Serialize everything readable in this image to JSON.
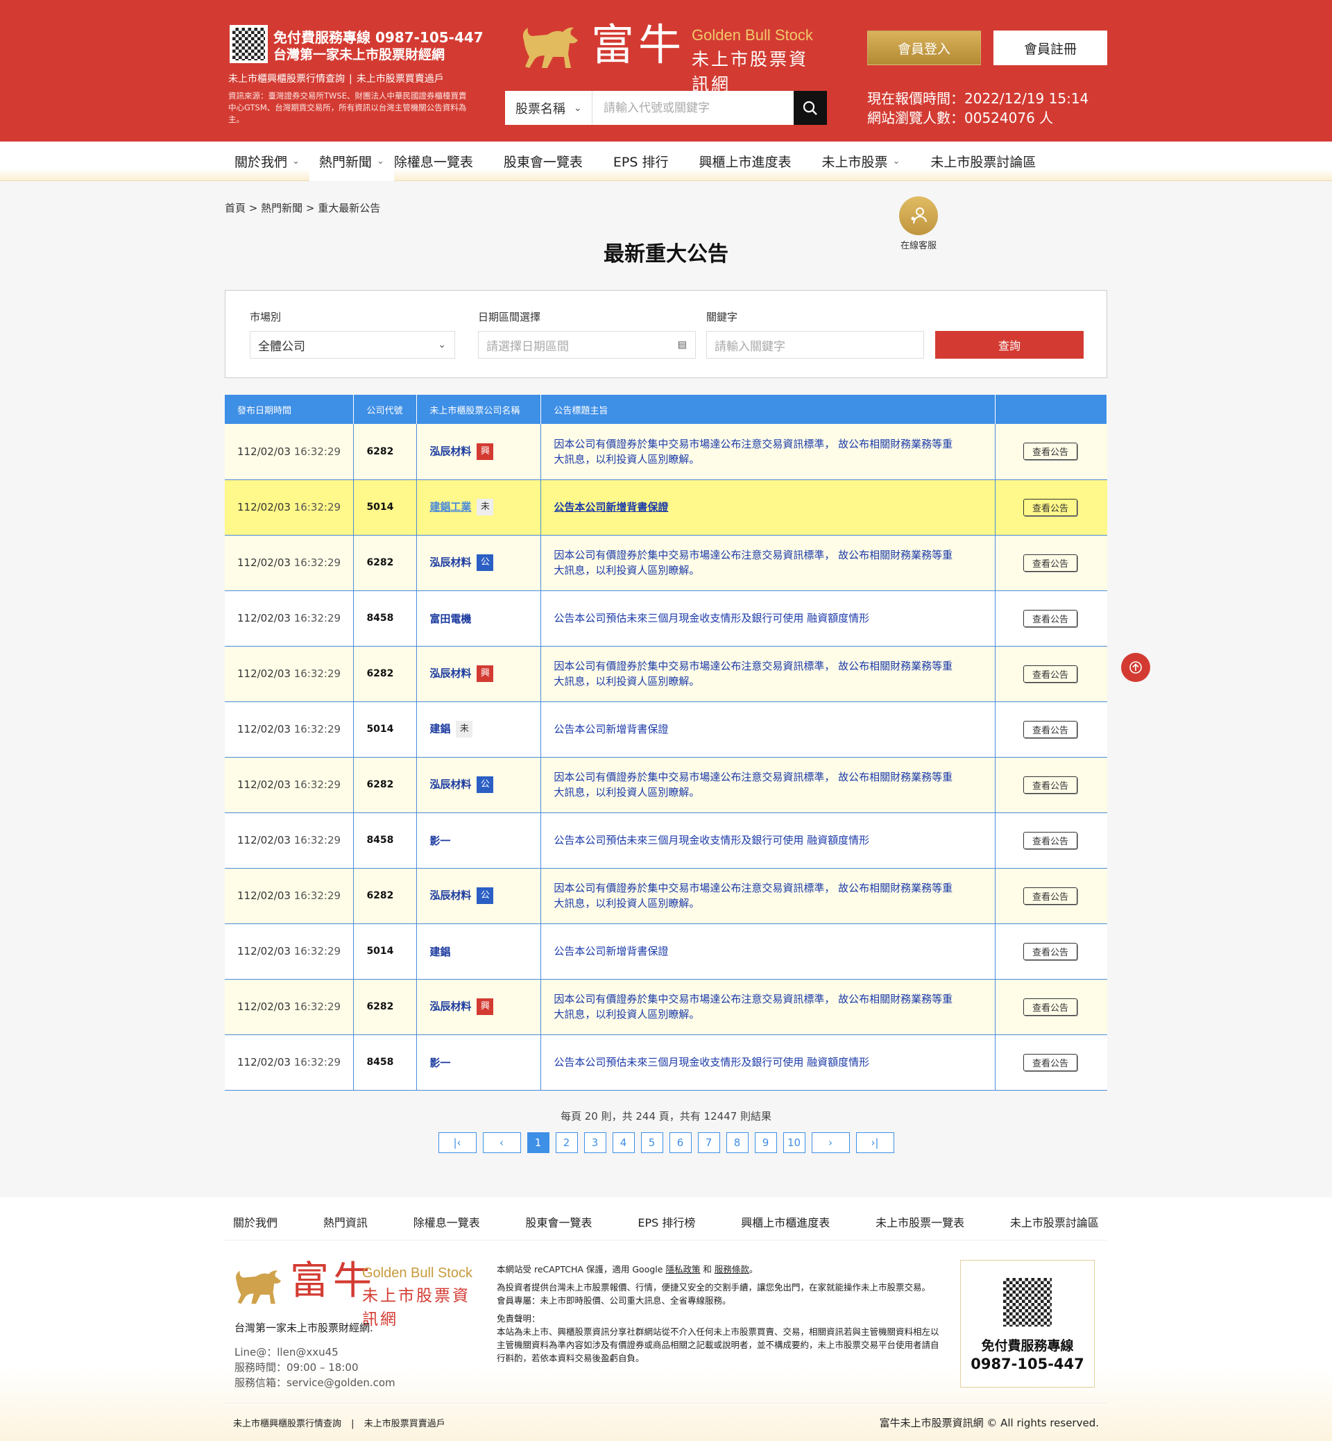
{
  "header": {
    "hotline": "免付費服務專線 0987-105-447",
    "slogan": "台灣第一家未上市股票財經網",
    "links": [
      "未上市櫃興櫃股票行情查詢",
      "|",
      "未上市股票買賣過戶"
    ],
    "source": "資訊來源：臺灣證券交易所TWSE、財團法人中華民國證券櫃檯買賣中心GTSM、台灣期貨交易所，所有資訊以台灣主管機關公告資料為主。",
    "logo_cn": "富牛",
    "logo_en": "Golden Bull Stock",
    "logo_sub": "未上市股票資訊網",
    "search_select": "股票名稱",
    "search_placeholder": "請輸入代號或關鍵字",
    "login": "會員登入",
    "register": "會員註冊",
    "quote_time": "現在報價時間：2022/12/19 15:14",
    "visitors": "網站瀏覽人數：00524076 人",
    "accent": "#d33b32"
  },
  "nav": [
    {
      "label": "關於我們",
      "dropdown": true
    },
    {
      "label": "熱門新聞",
      "dropdown": true,
      "active": true
    },
    {
      "label": "除權息一覽表"
    },
    {
      "label": "股東會一覽表"
    },
    {
      "label": "EPS 排行"
    },
    {
      "label": "興櫃上市進度表"
    },
    {
      "label": "未上市股票",
      "dropdown": true
    },
    {
      "label": "未上市股票討論區"
    }
  ],
  "breadcrumb": "首頁 > 熱門新聞 > 重大最新公告",
  "service_label": "在線客服",
  "page_title": "最新重大公告",
  "filter": {
    "market_label": "市場別",
    "market_value": "全體公司",
    "date_label": "日期區間選擇",
    "date_placeholder": "請選擇日期區間",
    "keyword_label": "關鍵字",
    "keyword_placeholder": "請輸入關鍵字",
    "query": "查詢"
  },
  "table": {
    "headers": [
      "發布日期時間",
      "公司代號",
      "未上市櫃股票公司名稱",
      "公告標題主旨",
      ""
    ],
    "view_label": "查看公告",
    "rows": [
      {
        "date": "112/02/03",
        "time": "16:32:29",
        "code": "6282",
        "name": "泓辰材料",
        "badge": "興",
        "btype": "xing",
        "subject": "因本公司有價證券於集中交易市場達公布注意交易資訊標準， 故公布相關財務業務等重大訊息，以利投資人區別瞭解。",
        "style": "alt"
      },
      {
        "date": "112/02/03",
        "time": "16:32:29",
        "code": "5014",
        "name": "建錩工業",
        "badge": "未",
        "btype": "wei",
        "subject": "公告本公司新增背書保證",
        "style": "hl"
      },
      {
        "date": "112/02/03",
        "time": "16:32:29",
        "code": "6282",
        "name": "泓辰材料",
        "badge": "公",
        "btype": "gong",
        "subject": "因本公司有價證券於集中交易市場達公布注意交易資訊標準， 故公布相關財務業務等重大訊息，以利投資人區別瞭解。",
        "style": "alt"
      },
      {
        "date": "112/02/03",
        "time": "16:32:29",
        "code": "8458",
        "name": "富田電機",
        "badge": "",
        "btype": "",
        "subject": "公告本公司預估未來三個月現金收支情形及銀行可使用 融資額度情形",
        "style": ""
      },
      {
        "date": "112/02/03",
        "time": "16:32:29",
        "code": "6282",
        "name": "泓辰材料",
        "badge": "興",
        "btype": "xing",
        "subject": "因本公司有價證券於集中交易市場達公布注意交易資訊標準， 故公布相關財務業務等重大訊息，以利投資人區別瞭解。",
        "style": "alt"
      },
      {
        "date": "112/02/03",
        "time": "16:32:29",
        "code": "5014",
        "name": "建錩",
        "badge": "未",
        "btype": "wei",
        "subject": "公告本公司新增背書保證",
        "style": ""
      },
      {
        "date": "112/02/03",
        "time": "16:32:29",
        "code": "6282",
        "name": "泓辰材料",
        "badge": "公",
        "btype": "gong",
        "subject": "因本公司有價證券於集中交易市場達公布注意交易資訊標準， 故公布相關財務業務等重大訊息，以利投資人區別瞭解。",
        "style": "alt"
      },
      {
        "date": "112/02/03",
        "time": "16:32:29",
        "code": "8458",
        "name": "影一",
        "badge": "",
        "btype": "",
        "subject": "公告本公司預估未來三個月現金收支情形及銀行可使用 融資額度情形",
        "style": ""
      },
      {
        "date": "112/02/03",
        "time": "16:32:29",
        "code": "6282",
        "name": "泓辰材料",
        "badge": "公",
        "btype": "gong",
        "subject": "因本公司有價證券於集中交易市場達公布注意交易資訊標準， 故公布相關財務業務等重大訊息，以利投資人區別瞭解。",
        "style": "alt"
      },
      {
        "date": "112/02/03",
        "time": "16:32:29",
        "code": "5014",
        "name": "建錩",
        "badge": "",
        "btype": "",
        "subject": "公告本公司新增背書保證",
        "style": ""
      },
      {
        "date": "112/02/03",
        "time": "16:32:29",
        "code": "6282",
        "name": "泓辰材料",
        "badge": "興",
        "btype": "xing",
        "subject": "因本公司有價證券於集中交易市場達公布注意交易資訊標準， 故公布相關財務業務等重大訊息，以利投資人區別瞭解。",
        "style": "alt"
      },
      {
        "date": "112/02/03",
        "time": "16:32:29",
        "code": "8458",
        "name": "影一",
        "badge": "",
        "btype": "",
        "subject": "公告本公司預估未來三個月現金收支情形及銀行可使用 融資額度情形",
        "style": ""
      }
    ]
  },
  "pagination": {
    "info": "每頁 20 則，共 244 頁，共有 12447 則結果",
    "pages": [
      "1",
      "2",
      "3",
      "4",
      "5",
      "6",
      "7",
      "8",
      "9",
      "10"
    ],
    "current": "1"
  },
  "footer": {
    "nav": [
      "關於我們",
      "熱門資訊",
      "除權息一覽表",
      "股東會一覽表",
      "EPS 排行榜",
      "興櫃上市櫃進度表",
      "未上市股票一覽表",
      "未上市股票討論區"
    ],
    "tagline": "台灣第一家未上市股票財經網.",
    "line": "Line@：llen@xxu45",
    "hours": "服務時間：09:00 – 18:00",
    "mail": "服務信箱：service@golden.com",
    "recaptcha_pre": "本網站受 reCAPTCHA 保護，適用 Google ",
    "privacy": "隱私政策",
    "and": " 和 ",
    "terms": "服務條款",
    "recaptcha_post": "。",
    "desc1": "為投資者提供台灣未上市股票報價、行情，便捷又安全的交割手續，讓您免出門，在家就能操作未上市股票交易。",
    "desc2": "會員專屬：未上市即時股價、公司重大訊息、全省專線服務。",
    "disclaimer_title": "免責聲明：",
    "disclaimer": "本站為未上市、興櫃股票資訊分享社群網站從不介入任何未上市股票買賣、交易，相關資訊若與主管機關資料相左以主管機關資料為準內容如涉及有價證券或商品相關之記載或說明者，並不構成要約，未上市股票交易平台使用者請自行斟酌，若依本資料交易後盈虧自負。",
    "qr_title": "免付費服務專線",
    "qr_phone": "0987-105-447",
    "bottom_links": [
      "未上市櫃興櫃股票行情查詢",
      "|",
      "未上市股票買賣過戶"
    ],
    "copyright": "富牛未上市股票資訊網 © All rights reserved."
  }
}
